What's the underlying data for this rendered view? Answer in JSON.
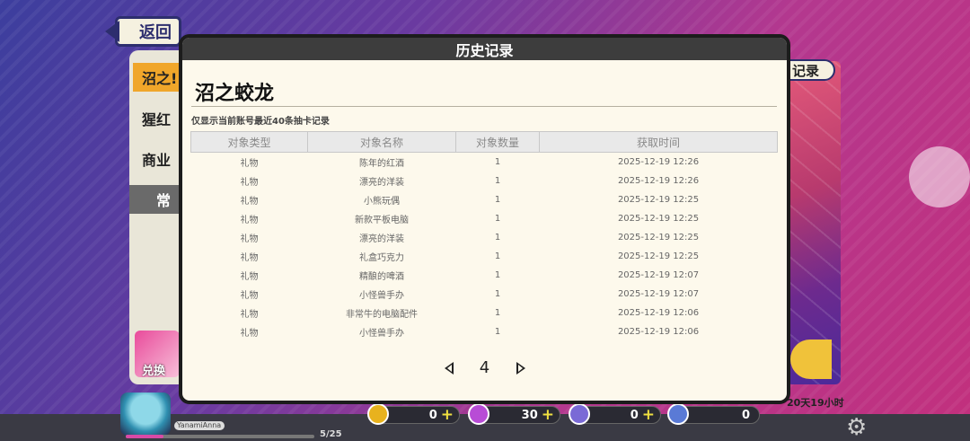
{
  "nav": {
    "back_label": "返回"
  },
  "side_tabs": [
    "沼之!",
    "猩红",
    "商业",
    "常"
  ],
  "side_bottom_label": "兑换",
  "right_panel": {
    "label": "记录",
    "timer": "20天19小时"
  },
  "player": {
    "name": "YanamiAnna",
    "xp_text": "5/25",
    "xp_fraction": 0.2
  },
  "resources": [
    {
      "icon": "gold-coin-icon",
      "value": "0",
      "plus": "+",
      "color": "#e8b21e"
    },
    {
      "icon": "purple-gem-icon",
      "value": "30",
      "plus": "+",
      "color": "#b84cd6"
    },
    {
      "icon": "ticket-icon",
      "value": "0",
      "plus": "+",
      "color": "#7a6ad6"
    },
    {
      "icon": "card-icon",
      "value": "0",
      "plus": "",
      "color": "#5a7ad6"
    }
  ],
  "modal": {
    "title": "历史记录",
    "pool_name": "沼之蛟龙",
    "note": "仅显示当前账号最近40条抽卡记录",
    "columns": [
      "对象类型",
      "对象名称",
      "对象数量",
      "获取时间"
    ],
    "rows": [
      [
        "礼物",
        "陈年的红酒",
        "1",
        "2025-12-19 12:26"
      ],
      [
        "礼物",
        "漂亮的洋装",
        "1",
        "2025-12-19 12:26"
      ],
      [
        "礼物",
        "小熊玩偶",
        "1",
        "2025-12-19 12:25"
      ],
      [
        "礼物",
        "新款平板电脑",
        "1",
        "2025-12-19 12:25"
      ],
      [
        "礼物",
        "漂亮的洋装",
        "1",
        "2025-12-19 12:25"
      ],
      [
        "礼物",
        "礼盒巧克力",
        "1",
        "2025-12-19 12:25"
      ],
      [
        "礼物",
        "精酿的啤酒",
        "1",
        "2025-12-19 12:07"
      ],
      [
        "礼物",
        "小怪兽手办",
        "1",
        "2025-12-19 12:07"
      ],
      [
        "礼物",
        "非常牛的电脑配件",
        "1",
        "2025-12-19 12:06"
      ],
      [
        "礼物",
        "小怪兽手办",
        "1",
        "2025-12-19 12:06"
      ]
    ],
    "page": "4"
  }
}
